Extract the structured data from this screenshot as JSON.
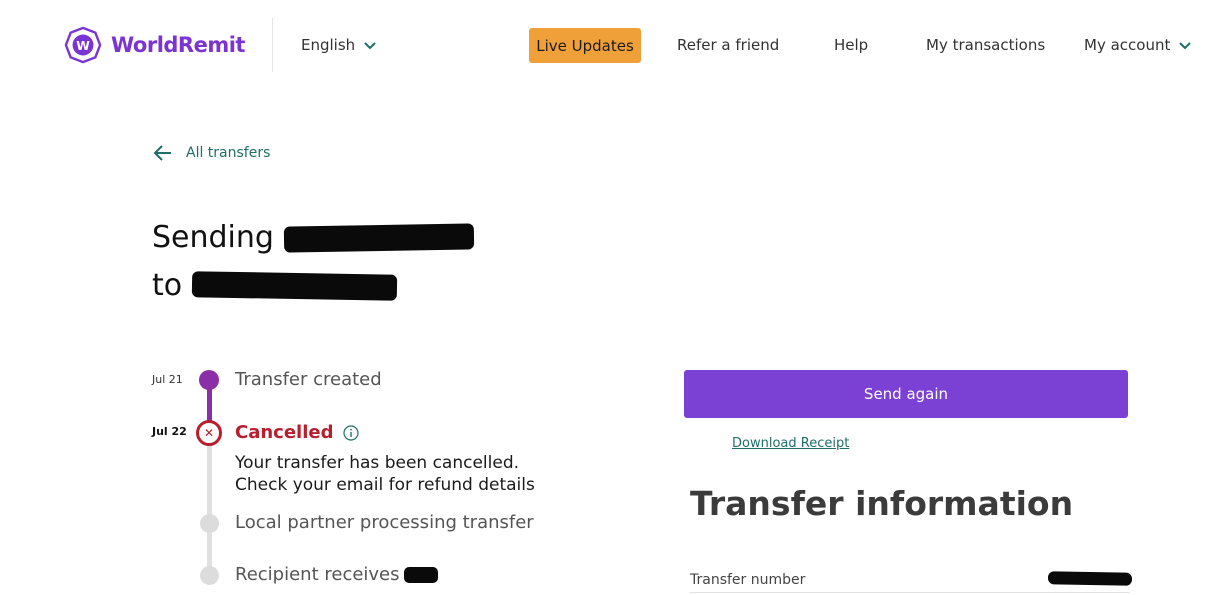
{
  "header": {
    "brand": "WorldRemit",
    "language": "English",
    "nav": {
      "live_updates": "Live Updates",
      "refer": "Refer a friend",
      "help": "Help",
      "transactions": "My transactions",
      "account": "My account"
    }
  },
  "back_link": "All transfers",
  "heading": {
    "line1_prefix": "Sending",
    "line2_prefix": "to"
  },
  "timeline": {
    "created": {
      "date": "Jul 21",
      "label": "Transfer created"
    },
    "cancelled": {
      "date": "Jul 22",
      "label": "Cancelled",
      "desc_line1": "Your transfer has been cancelled.",
      "desc_line2": "Check your email for refund details"
    },
    "processing": {
      "label": "Local partner processing transfer"
    },
    "receives": {
      "label": "Recipient receives"
    }
  },
  "actions": {
    "send_again": "Send again",
    "download_receipt": "Download Receipt"
  },
  "transfer_info": {
    "title": "Transfer information",
    "number_label": "Transfer number"
  },
  "colors": {
    "brand_purple": "#7b34d4",
    "live_updates_bg": "#f0a038",
    "cancel_red": "#b81e2d",
    "link_teal": "#1f6e67"
  }
}
